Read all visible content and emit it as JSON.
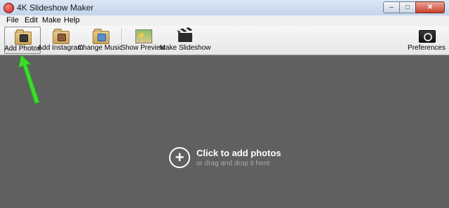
{
  "window": {
    "title": "4K Slideshow Maker",
    "minimize": "–",
    "maximize": "□",
    "close": "✕"
  },
  "menu": [
    "File",
    "Edit",
    "Make",
    "Help"
  ],
  "toolbar": {
    "add_photos": "Add Photos",
    "add_instagram": "Add Instagram",
    "change_music": "Change Music",
    "show_preview": "Show Preview",
    "make_slideshow": "Make Slideshow",
    "preferences": "Preferences"
  },
  "main": {
    "plus_symbol": "+",
    "click_to_add": "Click to add photos",
    "drag_hint": "or drag and drop it here"
  },
  "colors": {
    "workspace": "#606060",
    "annotation_arrow": "#3ddc2a"
  },
  "icons": {
    "add_photos": "folder-camera-icon",
    "add_instagram": "folder-instagram-icon",
    "change_music": "folder-music-icon",
    "show_preview": "preview-image-icon",
    "make_slideshow": "clapperboard-icon",
    "preferences": "preferences-icon"
  }
}
